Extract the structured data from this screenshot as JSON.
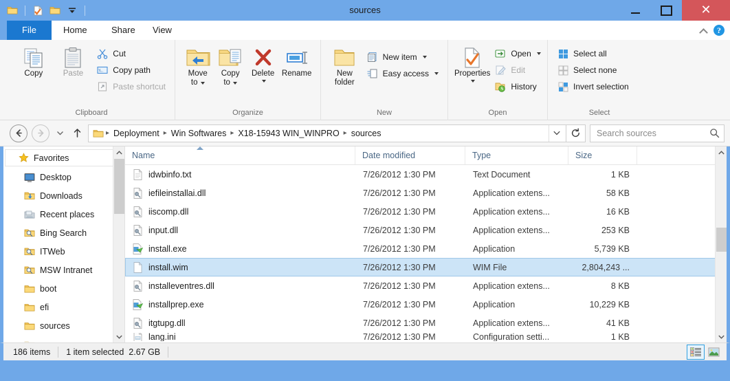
{
  "window": {
    "title": "sources",
    "accent_color": "#6fa8e8",
    "close_color": "#d4565a",
    "controls": {
      "minimize": "minimize-button",
      "maximize": "maximize-button",
      "close": "✕"
    }
  },
  "quick_access": {
    "items": [
      {
        "name": "folder-icon",
        "label": ""
      },
      {
        "name": "properties-icon",
        "label": ""
      },
      {
        "name": "new-folder-icon",
        "label": ""
      },
      {
        "name": "customize-qat-caret",
        "label": ""
      }
    ]
  },
  "tabs": [
    {
      "id": "file",
      "label": "File"
    },
    {
      "id": "home",
      "label": "Home"
    },
    {
      "id": "share",
      "label": "Share"
    },
    {
      "id": "view",
      "label": "View"
    }
  ],
  "ribbon": {
    "collapse_icon": "chevron-up-icon",
    "help_icon": "?",
    "groups": [
      {
        "label": "Clipboard",
        "big": [
          {
            "label": "Copy",
            "icon": "copy-icon",
            "disabled": false
          },
          {
            "label": "Paste",
            "icon": "paste-icon",
            "disabled": true
          }
        ],
        "small": [
          {
            "label": "Cut",
            "icon": "scissors-icon",
            "disabled": false
          },
          {
            "label": "Copy path",
            "icon": "copy-path-icon",
            "disabled": false
          },
          {
            "label": "Paste shortcut",
            "icon": "paste-shortcut-icon",
            "disabled": true
          }
        ]
      },
      {
        "label": "Organize",
        "big": [
          {
            "label": "Move\nto",
            "label1": "Move",
            "label2": "to",
            "icon": "move-to-icon",
            "caret": true
          },
          {
            "label": "Copy\nto",
            "label1": "Copy",
            "label2": "to",
            "icon": "copy-to-icon",
            "caret": true
          },
          {
            "label": "Delete",
            "label1": "Delete",
            "label2": "",
            "icon": "delete-icon",
            "caret": true
          },
          {
            "label": "Rename",
            "label1": "Rename",
            "label2": "",
            "icon": "rename-icon",
            "caret": false
          }
        ],
        "small": []
      },
      {
        "label": "New",
        "big": [
          {
            "label": "New folder",
            "label1": "New",
            "label2": "folder",
            "icon": "new-folder-icon",
            "caret": false
          }
        ],
        "small": [
          {
            "label": "New item",
            "icon": "new-item-icon",
            "caret": true
          },
          {
            "label": "Easy access",
            "icon": "easy-access-icon",
            "caret": true
          }
        ]
      },
      {
        "label": "Open",
        "big": [
          {
            "label": "Properties",
            "label1": "Properties",
            "label2": "",
            "icon": "properties-icon",
            "caret": true
          }
        ],
        "small": [
          {
            "label": "Open",
            "icon": "open-icon",
            "caret": true,
            "disabled": false
          },
          {
            "label": "Edit",
            "icon": "edit-icon",
            "caret": false,
            "disabled": true
          },
          {
            "label": "History",
            "icon": "history-icon",
            "caret": false,
            "disabled": false
          }
        ]
      },
      {
        "label": "Select",
        "big": [],
        "small": [
          {
            "label": "Select all",
            "icon": "select-all-icon"
          },
          {
            "label": "Select none",
            "icon": "select-none-icon"
          },
          {
            "label": "Invert selection",
            "icon": "invert-selection-icon"
          }
        ]
      }
    ]
  },
  "address": {
    "back": "←",
    "forward": "→",
    "up": "↑",
    "breadcrumbs": [
      "Deployment",
      "Win Softwares",
      "X18-15943 WIN_WINPRO",
      "sources"
    ],
    "separator": "▸",
    "dropdown_icon": "chevron-down-icon",
    "refresh_icon": "refresh-icon"
  },
  "search": {
    "placeholder": "Search sources",
    "icon": "search-icon"
  },
  "sidebar": {
    "items": [
      {
        "label": "Favorites",
        "icon": "star-icon",
        "header": true
      },
      {
        "label": "Desktop",
        "icon": "desktop-icon",
        "header": false
      },
      {
        "label": "Downloads",
        "icon": "downloads-folder-icon",
        "header": false
      },
      {
        "label": "Recent places",
        "icon": "recent-places-icon",
        "header": false
      },
      {
        "label": "Bing Search",
        "icon": "search-folder-icon",
        "header": false
      },
      {
        "label": "ITWeb",
        "icon": "search-folder-icon",
        "header": false
      },
      {
        "label": "MSW Intranet",
        "icon": "search-folder-icon",
        "header": false
      },
      {
        "label": "boot",
        "icon": "folder-icon",
        "header": false
      },
      {
        "label": "efi",
        "icon": "folder-icon",
        "header": false
      },
      {
        "label": "sources",
        "icon": "folder-icon",
        "header": false
      },
      {
        "label": "",
        "icon": "folder-icon",
        "header": false
      }
    ]
  },
  "filelist": {
    "columns": [
      {
        "key": "name",
        "label": "Name",
        "sorted": "asc"
      },
      {
        "key": "date",
        "label": "Date modified",
        "sorted": ""
      },
      {
        "key": "type",
        "label": "Type",
        "sorted": ""
      },
      {
        "key": "size",
        "label": "Size",
        "sorted": ""
      }
    ],
    "rows": [
      {
        "name": "idwbinfo.txt",
        "date": "7/26/2012 1:30 PM",
        "type": "Text Document",
        "size": "1 KB",
        "icon": "text-file-icon",
        "selected": false
      },
      {
        "name": "iefileinstallai.dll",
        "date": "7/26/2012 1:30 PM",
        "type": "Application extens...",
        "size": "58 KB",
        "icon": "dll-file-icon",
        "selected": false
      },
      {
        "name": "iiscomp.dll",
        "date": "7/26/2012 1:30 PM",
        "type": "Application extens...",
        "size": "16 KB",
        "icon": "dll-file-icon",
        "selected": false
      },
      {
        "name": "input.dll",
        "date": "7/26/2012 1:30 PM",
        "type": "Application extens...",
        "size": "253 KB",
        "icon": "dll-file-icon",
        "selected": false
      },
      {
        "name": "install.exe",
        "date": "7/26/2012 1:30 PM",
        "type": "Application",
        "size": "5,739 KB",
        "icon": "exe-file-icon",
        "selected": false
      },
      {
        "name": "install.wim",
        "date": "7/26/2012 1:30 PM",
        "type": "WIM File",
        "size": "2,804,243 ...",
        "icon": "blank-file-icon",
        "selected": true
      },
      {
        "name": "installeventres.dll",
        "date": "7/26/2012 1:30 PM",
        "type": "Application extens...",
        "size": "8 KB",
        "icon": "dll-file-icon",
        "selected": false
      },
      {
        "name": "installprep.exe",
        "date": "7/26/2012 1:30 PM",
        "type": "Application",
        "size": "10,229 KB",
        "icon": "exe-file-icon",
        "selected": false
      },
      {
        "name": "itgtupg.dll",
        "date": "7/26/2012 1:30 PM",
        "type": "Application extens...",
        "size": "41 KB",
        "icon": "dll-file-icon",
        "selected": false
      },
      {
        "name": "lang.ini",
        "date": "7/26/2012 1:30 PM",
        "type": "Configuration setti...",
        "size": "1 KB",
        "icon": "ini-file-icon",
        "selected": false
      }
    ]
  },
  "status": {
    "item_count": "186 items",
    "selection": "1 item selected",
    "selection_size": "2.67 GB",
    "views": [
      {
        "name": "details-view-button",
        "active": true
      },
      {
        "name": "large-icons-view-button",
        "active": false
      }
    ]
  }
}
